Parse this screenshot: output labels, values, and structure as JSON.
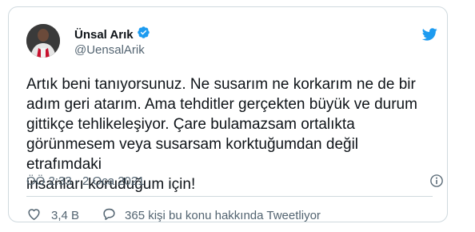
{
  "user": {
    "display_name": "Ünsal Arık",
    "handle": "@UensalArik",
    "verified_icon": "verified-badge-icon",
    "avatar": "profile-photo"
  },
  "brand": {
    "logo": "twitter-bird-icon",
    "color": "#1d9bf0"
  },
  "tweet": {
    "text": "Artık beni tanıyorsunuz. Ne susarım ne korkarım ne de bir\nadım geri atarım. Ama tehditler gerçekten büyük ve durum\ngittikçe tehlikeleşiyor. Çare bulamazsam ortalıkta\ngörünmesem veya susarsam korktuğumdan değil etrafımdaki\ninsanları koruduğum için!",
    "timestamp": "ÖÖ 2:33 · 2 Oca 2021"
  },
  "actions": {
    "like_icon": "heart-icon",
    "like_count": "3,4 B",
    "reply_icon": "speech-bubble-icon",
    "reply_label": "365 kişi bu konu hakkında Tweetliyor",
    "info_icon": "info-icon"
  },
  "colors": {
    "text": "#0f1419",
    "secondary": "#536471",
    "border": "#cfd9de"
  }
}
